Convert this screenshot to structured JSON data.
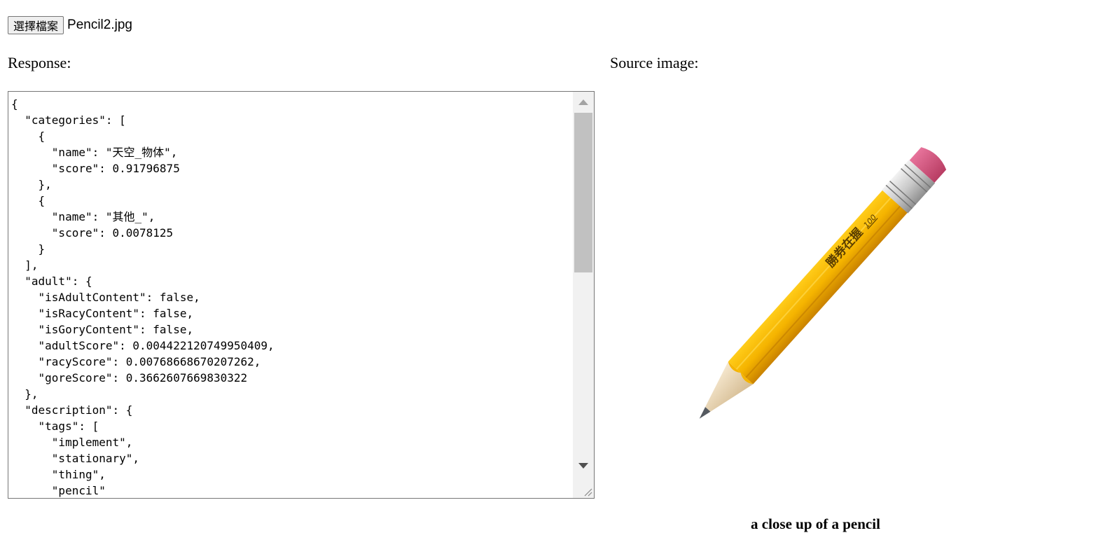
{
  "file_input": {
    "button_label": "選擇檔案",
    "file_name": "Pencil2.jpg"
  },
  "response": {
    "label": "Response:",
    "json_text": "{\n  \"categories\": [\n    {\n      \"name\": \"天空_物体\",\n      \"score\": 0.91796875\n    },\n    {\n      \"name\": \"其他_\",\n      \"score\": 0.0078125\n    }\n  ],\n  \"adult\": {\n    \"isAdultContent\": false,\n    \"isRacyContent\": false,\n    \"isGoryContent\": false,\n    \"adultScore\": 0.004422120749950409,\n    \"racyScore\": 0.00768668670207262,\n    \"goreScore\": 0.3662607669830322\n  },\n  \"description\": {\n    \"tags\": [\n      \"implement\",\n      \"stationary\",\n      \"thing\",\n      \"pencil\""
  },
  "source": {
    "label": "Source image:",
    "caption": "a close up of a pencil",
    "pencil_text": "勝券在握",
    "pencil_number": "100"
  },
  "colors": {
    "pencil_body": "#f5b400",
    "pencil_shadow": "#d08a00",
    "eraser": "#d9547e",
    "ferrule": "#c9c9c9",
    "wood": "#ecd9b8",
    "lead": "#555a60"
  }
}
